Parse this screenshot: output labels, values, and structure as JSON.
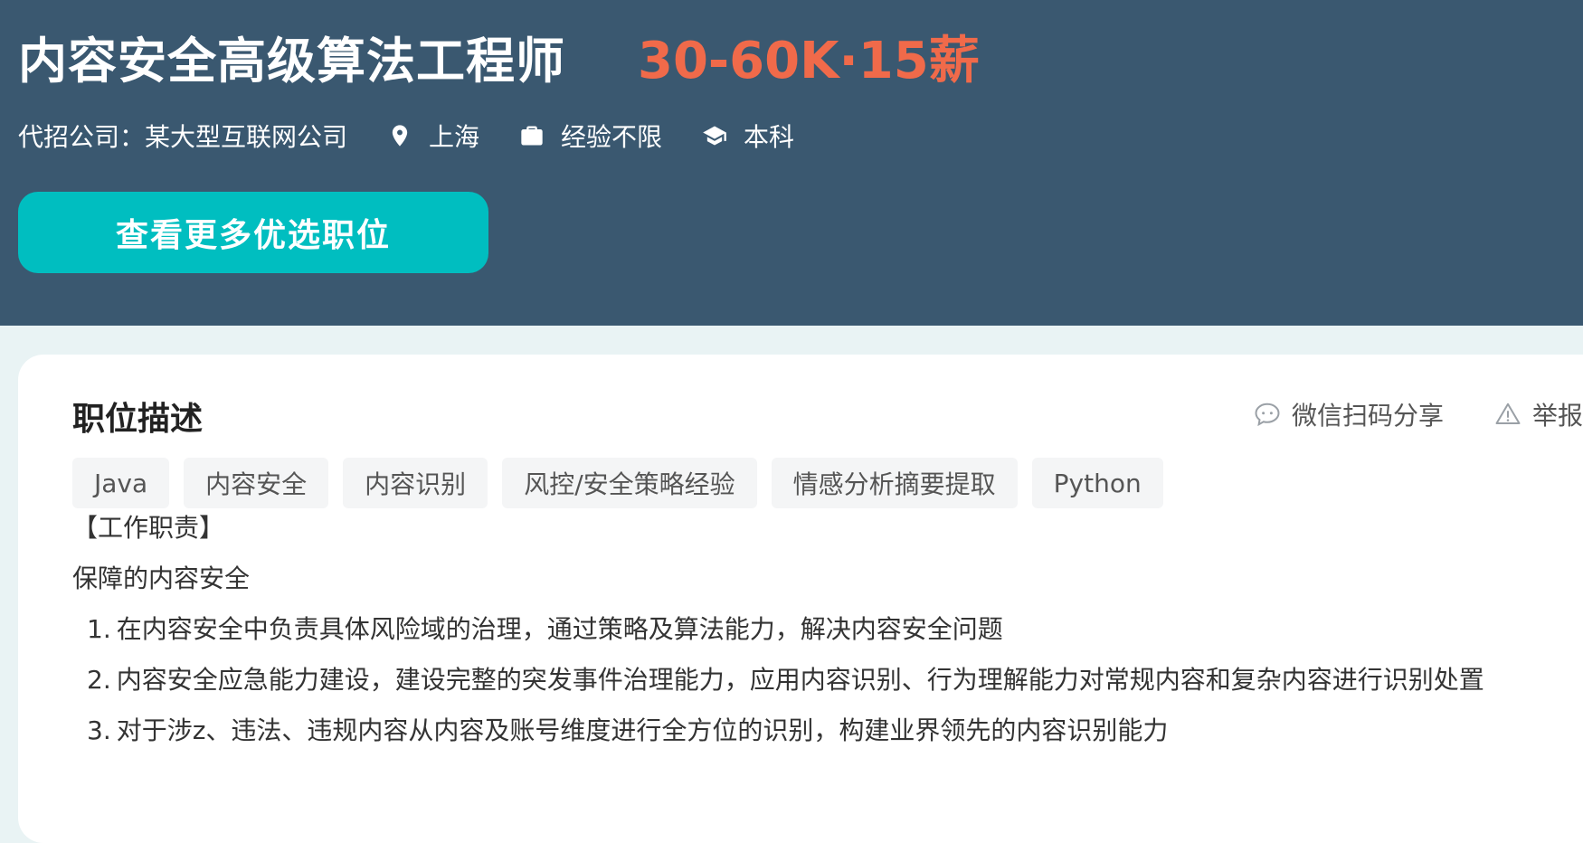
{
  "header": {
    "job_title": "内容安全高级算法工程师",
    "salary": "30-60K·15薪",
    "company": "代招公司：某大型互联网公司",
    "location": "上海",
    "experience": "经验不限",
    "education": "本科",
    "cta_label": "查看更多优选职位"
  },
  "colors": {
    "header_bg": "#3a5870",
    "salary": "#f06a4a",
    "cta": "#00bec0",
    "page_bg": "#e9f3f4"
  },
  "description": {
    "section_title": "职位描述",
    "share_label": "微信扫码分享",
    "report_label": "举报",
    "tags": [
      "Java",
      "内容安全",
      "内容识别",
      "风控/安全策略经验",
      "情感分析摘要提取",
      "Python"
    ],
    "heading": "【工作职责】",
    "intro": "保障的内容安全",
    "items": [
      {
        "num": "1.",
        "text": "在内容安全中负责具体风险域的治理，通过策略及算法能力，解决内容安全问题"
      },
      {
        "num": "2.",
        "text": "内容安全应急能力建设，建设完整的突发事件治理能力，应用内容识别、行为理解能力对常规内容和复杂内容进行识别处置"
      },
      {
        "num": "3.",
        "text": "对于涉z、违法、违规内容从内容及账号维度进行全方位的识别，构建业界领先的内容识别能力"
      }
    ]
  }
}
